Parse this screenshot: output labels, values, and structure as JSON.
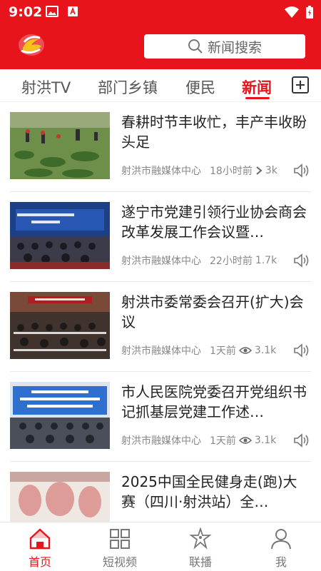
{
  "status_bar": {
    "time": "9:02",
    "icons_left": [
      "image-icon",
      "app-a-icon"
    ],
    "icons_right": [
      "wifi-icon",
      "battery-charging-icon"
    ]
  },
  "header": {
    "logo": "app-logo",
    "search_placeholder": "新闻搜索",
    "background_color": "#e8141b"
  },
  "tabs": [
    {
      "label": "射洪TV",
      "active": false
    },
    {
      "label": "部门乡镇",
      "active": false
    },
    {
      "label": "便民",
      "active": false
    },
    {
      "label": "新闻",
      "active": true
    }
  ],
  "tab_add_icon": "plus-square-icon",
  "news": [
    {
      "title": "春耕时节丰收忙，丰产丰收盼头足",
      "source": "射洪市融媒体中心",
      "time": "18小时前",
      "views_icon": "arrow-icon",
      "views": "3k"
    },
    {
      "title": "遂宁市党建引领行业协会商会改革发展工作会议暨…",
      "source": "射洪市融媒体中心",
      "time": "22小时前",
      "views_icon": "",
      "views": "1.7k"
    },
    {
      "title": "射洪市委常委会召开(扩大)会议",
      "source": "射洪市融媒体中心",
      "time": "1天前",
      "views_icon": "eye-icon",
      "views": "3.1k"
    },
    {
      "title": "市人民医院党委召开党组织书记抓基层党建工作述…",
      "source": "射洪市融媒体中心",
      "time": "1天前",
      "views_icon": "eye-icon",
      "views": "3.1k"
    },
    {
      "title": "2025中国全民健身走(跑)大赛（四川·射洪站）全…",
      "source": "",
      "time": "",
      "views_icon": "",
      "views": ""
    }
  ],
  "bottom_nav": [
    {
      "label": "首页",
      "icon": "home-icon",
      "active": true
    },
    {
      "label": "短视频",
      "icon": "grid-icon",
      "active": false
    },
    {
      "label": "联播",
      "icon": "star-figure-icon",
      "active": false
    },
    {
      "label": "我",
      "icon": "user-icon",
      "active": false
    }
  ],
  "colors": {
    "accent": "#e8141b",
    "text": "#222222",
    "meta": "#888888"
  }
}
